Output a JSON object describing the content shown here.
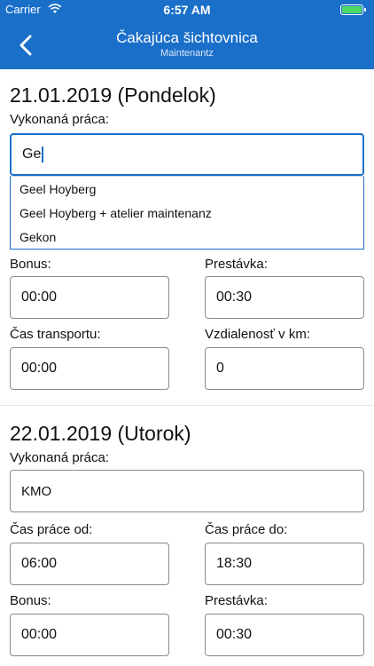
{
  "status": {
    "carrier": "Carrier",
    "time": "6:57 AM"
  },
  "header": {
    "title": "Čakajúca šichtovnica",
    "subtitle": "Maintenantz"
  },
  "days": [
    {
      "date": "21.01.2019 (Pondelok)",
      "work_label": "Vykonaná práca:",
      "work_value": "Ge",
      "suggestions": [
        "Geel Hoyberg",
        "Geel Hoyberg + atelier maintenanz",
        "Gekon"
      ],
      "bonus_label": "Bonus:",
      "bonus_value": "00:00",
      "break_label": "Prestávka:",
      "break_value": "00:30",
      "transport_label": "Čas transportu:",
      "transport_value": "00:00",
      "distance_label": "Vzdialenosť v km:",
      "distance_value": "0"
    },
    {
      "date": "22.01.2019 (Utorok)",
      "work_label": "Vykonaná práca:",
      "work_value": "KMO",
      "from_label": "Čas práce od:",
      "from_value": "06:00",
      "to_label": "Čas práce do:",
      "to_value": "18:30",
      "bonus_label": "Bonus:",
      "bonus_value": "00:00",
      "break_label": "Prestávka:",
      "break_value": "00:30"
    }
  ]
}
